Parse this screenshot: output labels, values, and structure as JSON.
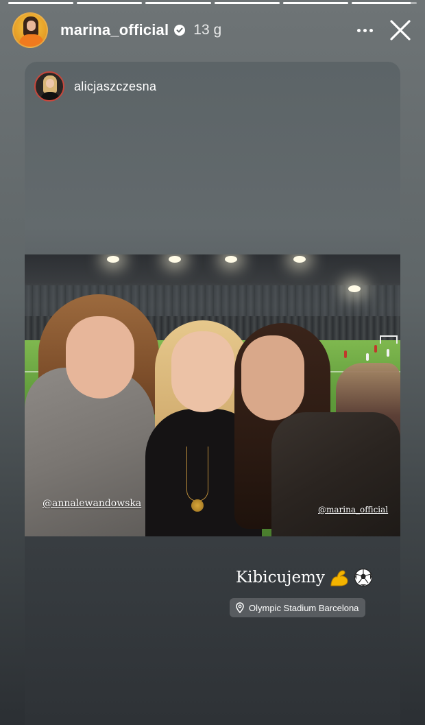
{
  "story": {
    "progress": [
      1,
      1,
      1,
      1,
      1,
      0.9
    ],
    "author": {
      "username": "marina_official",
      "verified": true,
      "time_ago": "13 g"
    },
    "icons": {
      "more": "more-dots-icon",
      "close": "close-icon",
      "verified": "verified-badge-icon",
      "location": "location-pin-icon"
    }
  },
  "shared_post": {
    "username": "alicjaszczesna",
    "tags": [
      "@annalewandowska",
      "@marina_official"
    ],
    "caption": "Kibicujemy",
    "caption_emoji": [
      "flexed-biceps",
      "soccer-ball"
    ],
    "location": "Olympic Stadium Barcelona"
  }
}
